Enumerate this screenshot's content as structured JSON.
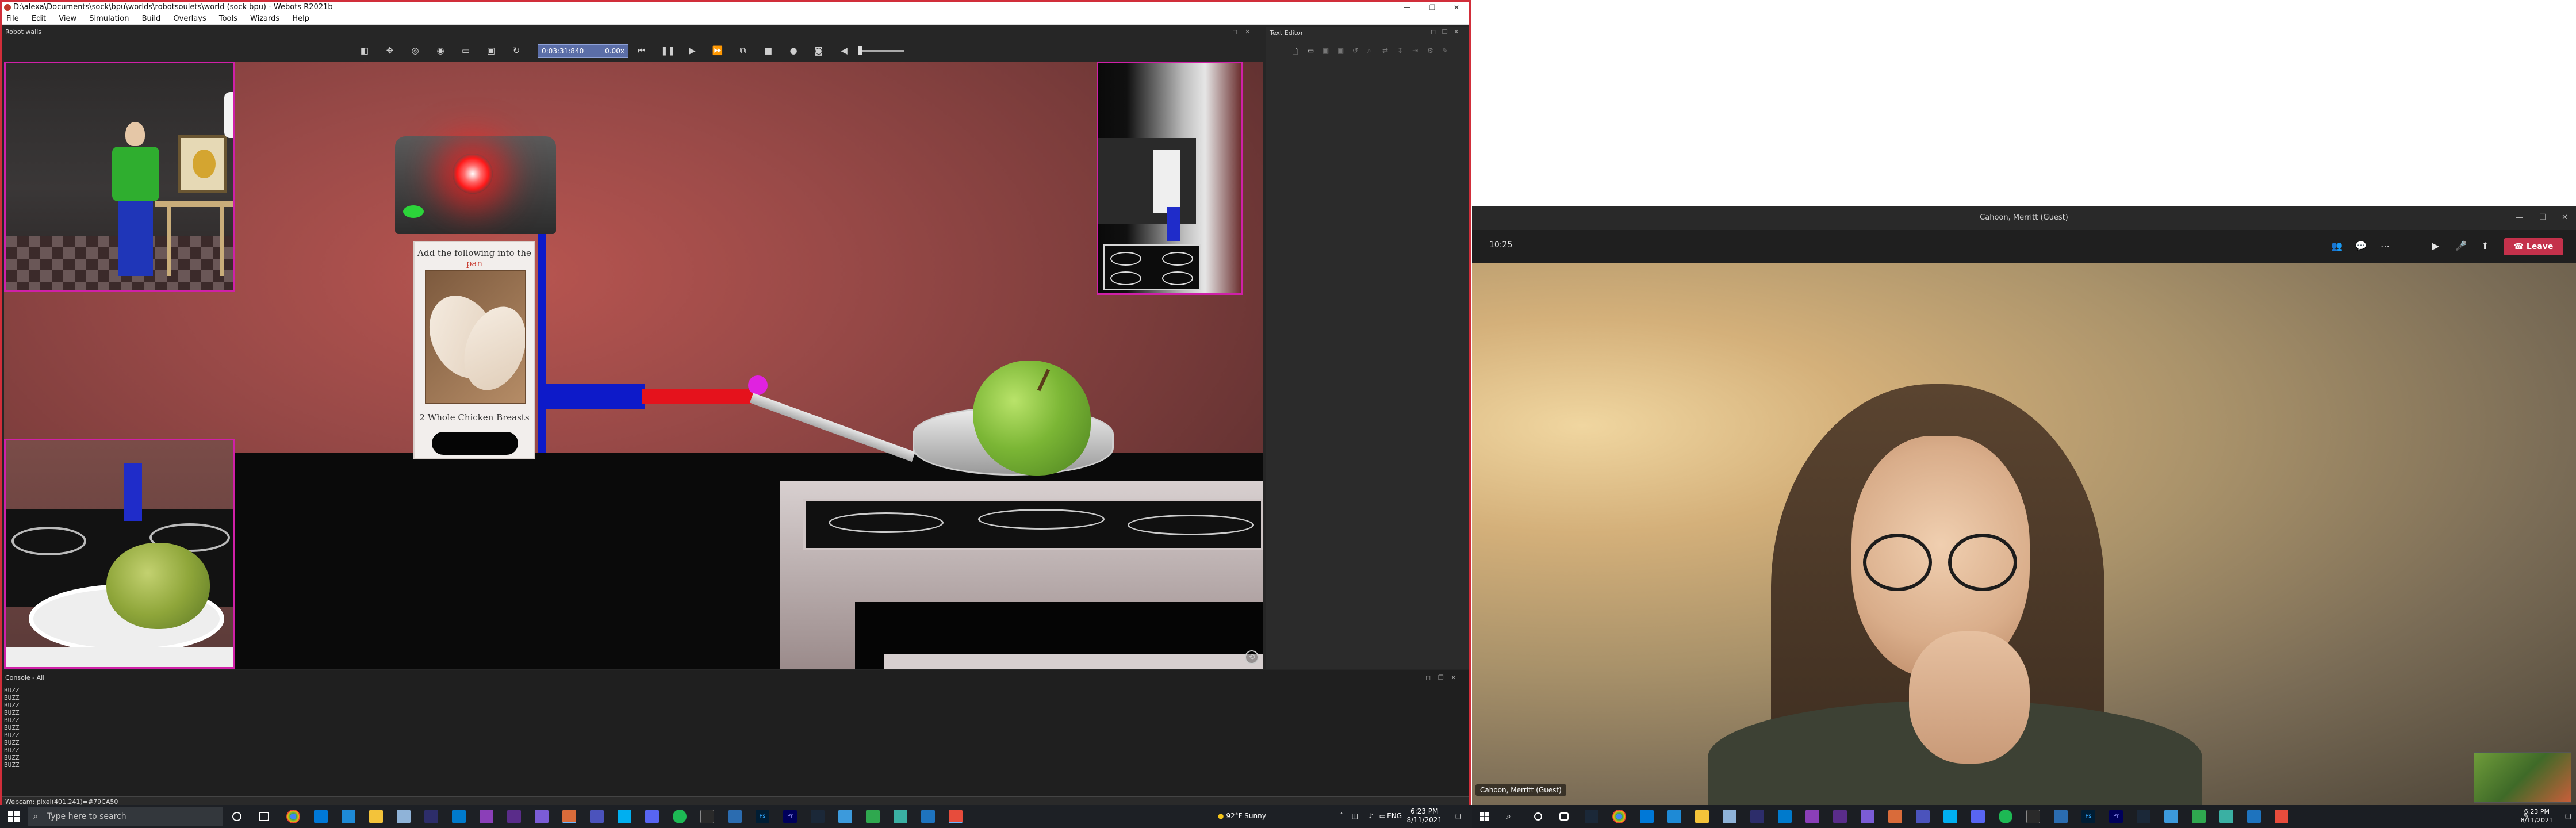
{
  "webots": {
    "window_title": "D:\\alexa\\Documents\\sock\\bpu\\worlds\\robotsoulets\\world (sock bpu) - Webots R2021b",
    "menu": [
      "File",
      "Edit",
      "View",
      "Simulation",
      "Build",
      "Overlays",
      "Tools",
      "Wizards",
      "Help"
    ],
    "robot_panel_title": "Robot walls",
    "sim_time": "0:03:31:840",
    "sim_speed": "0.00x",
    "recipe_card": {
      "title_prefix": "Add the following into the ",
      "title_highlight": "pan",
      "caption": "2 Whole Chicken Breasts"
    },
    "text_editor_title": "Text Editor",
    "console_title": "Console - All",
    "console_lines": [
      "BUZZ",
      "BUZZ",
      "BUZZ",
      "BUZZ",
      "BUZZ",
      "BUZZ",
      "BUZZ",
      "BUZZ",
      "BUZZ",
      "BUZZ",
      "BUZZ"
    ],
    "status_text": "Webcam: pixel(401,241)=#79CA50",
    "colors": {
      "accent_border": "#d12e3a",
      "time_field": "#5b6ea8",
      "overlay_border": "#d020a8"
    }
  },
  "taskbar_left": {
    "search_placeholder": "Type here to search",
    "weather": "92°F  Sunny",
    "lang": "ENG",
    "time": "6:23 PM",
    "date": "8/11/2021"
  },
  "teams": {
    "title": "Cahoon, Merritt (Guest)",
    "call_timer": "10:25",
    "leave_label": "Leave",
    "participant_name": "Cahoon, Merritt (Guest)",
    "colors": {
      "leave": "#c4314b"
    }
  },
  "taskbar_right": {
    "time": "6:23 PM",
    "date": "8/11/2021"
  },
  "icons": {
    "webots_toolbar": [
      "view-icon",
      "follow-icon",
      "perspective-icon",
      "eye-icon",
      "open-world-icon",
      "save-world-icon",
      "reload-icon",
      "step-back-icon",
      "pause-icon",
      "play-icon",
      "fast-forward-icon",
      "step-icon",
      "stop-icon",
      "record-icon",
      "screenshot-icon",
      "sound-icon"
    ],
    "teams_callbar": [
      "people-icon",
      "chat-icon",
      "more-icon",
      "camera-icon",
      "mic-icon",
      "share-icon"
    ]
  }
}
